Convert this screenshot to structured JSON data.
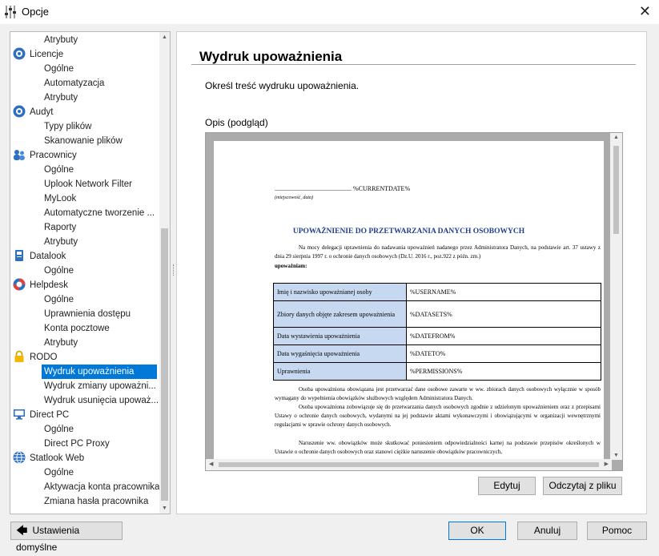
{
  "window": {
    "title": "Opcje"
  },
  "tree": {
    "items": [
      {
        "label": "Atrybuty",
        "level": 2,
        "icon": ""
      },
      {
        "label": "Licencje",
        "level": 1,
        "icon": "licence-disc-icon"
      },
      {
        "label": "Ogólne",
        "level": 2,
        "icon": ""
      },
      {
        "label": "Automatyzacja",
        "level": 2,
        "icon": ""
      },
      {
        "label": "Atrybuty",
        "level": 2,
        "icon": ""
      },
      {
        "label": "Audyt",
        "level": 1,
        "icon": "audit-disc-icon"
      },
      {
        "label": "Typy plików",
        "level": 2,
        "icon": ""
      },
      {
        "label": "Skanowanie plików",
        "level": 2,
        "icon": ""
      },
      {
        "label": "Pracownicy",
        "level": 1,
        "icon": "users-icon"
      },
      {
        "label": "Ogólne",
        "level": 2,
        "icon": ""
      },
      {
        "label": "Uplook Network Filter",
        "level": 2,
        "icon": ""
      },
      {
        "label": "MyLook",
        "level": 2,
        "icon": ""
      },
      {
        "label": "Automatyczne tworzenie ...",
        "level": 2,
        "icon": ""
      },
      {
        "label": "Raporty",
        "level": 2,
        "icon": ""
      },
      {
        "label": "Atrybuty",
        "level": 2,
        "icon": ""
      },
      {
        "label": "Datalook",
        "level": 1,
        "icon": "datalook-icon"
      },
      {
        "label": "Ogólne",
        "level": 2,
        "icon": ""
      },
      {
        "label": "Helpdesk",
        "level": 1,
        "icon": "helpdesk-icon"
      },
      {
        "label": "Ogólne",
        "level": 2,
        "icon": ""
      },
      {
        "label": "Uprawnienia dostępu",
        "level": 2,
        "icon": ""
      },
      {
        "label": "Konta pocztowe",
        "level": 2,
        "icon": ""
      },
      {
        "label": "Atrybuty",
        "level": 2,
        "icon": ""
      },
      {
        "label": "RODO",
        "level": 1,
        "icon": "lock-icon"
      },
      {
        "label": "Wydruk upoważnienia",
        "level": 2,
        "icon": "",
        "selected": true
      },
      {
        "label": "Wydruk zmiany upoważni...",
        "level": 2,
        "icon": ""
      },
      {
        "label": "Wydruk usunięcia upoważ...",
        "level": 2,
        "icon": ""
      },
      {
        "label": "Direct PC",
        "level": 1,
        "icon": "direct-pc-icon"
      },
      {
        "label": "Ogólne",
        "level": 2,
        "icon": ""
      },
      {
        "label": "Direct PC Proxy",
        "level": 2,
        "icon": ""
      },
      {
        "label": "Statlook Web",
        "level": 1,
        "icon": "statlook-web-icon"
      },
      {
        "label": "Ogólne",
        "level": 2,
        "icon": ""
      },
      {
        "label": "Aktywacja konta pracownika",
        "level": 2,
        "icon": ""
      },
      {
        "label": "Zmiana hasła pracownika",
        "level": 2,
        "icon": ""
      }
    ]
  },
  "main": {
    "title": "Wydruk upoważnienia",
    "description": "Określ treść wydruku upoważnienia.",
    "preview_label": "Opis (podgląd)",
    "edit_button": "Edytuj",
    "load_button": "Odczytaj z pliku"
  },
  "document": {
    "date_line": "................................................ %CURRENTDATE%",
    "place_line": "(miejscowość, data)",
    "heading": "UPOWAŻNIENIE DO PRZETWARZANIA DANYCH OSOBOWYCH",
    "intro": "Na mocy delegacji uprawnienia do nadawania upoważnień nadanego przez Administratora Danych, na podstawie art. 37 ustawy z dnia 29 sierpnia 1997 r. o ochronie danych osobowych (Dz.U. 2016 r., poz.922 z późn. zm.)",
    "authorize": "upoważniam:",
    "rows": [
      {
        "key": "Imię i nazwisko upoważnianej osoby",
        "value": "%USERNAME%"
      },
      {
        "key": "Zbiory danych objęte zakresem upoważnienia",
        "value": "%DATASETS%"
      },
      {
        "key": "Data wystawienia upoważnienia",
        "value": "%DATEFROM%"
      },
      {
        "key": "Data wygaśnięcia upoważnienia",
        "value": "%DATETO%"
      },
      {
        "key": "Uprawnienia",
        "value": "%PERMISSIONS%"
      }
    ],
    "para1": "Osoba upoważniona obowiązana jest przetwarzać dane osobowe zawarte w ww. zbiorach danych osobowych wyłącznie w sposób wymagany do wypełnienia obowiązków służbowych względem Administratora Danych.",
    "para2": "Osoba upoważniona zobowiązuje się do przetwarzania danych osobowych zgodnie z udzielonym upoważnieniem oraz z przepisami Ustawy o ochronie danych osobowych, wydanymi na jej podstawie aktami wykonawczymi i obowiązującymi w organizacji wewnętrznymi regulacjami w sprawie ochrony danych osobowych.",
    "para3": "Naruszenie ww. obowiązków może skutkować poniesieniem odpowiedzialności karnej na podstawie przepisów określonych w Ustawie o ochronie danych osobowych oraz stanowi ciężkie naruszenie obowiązków pracowniczych,"
  },
  "footer": {
    "defaults_button": "Ustawienia domyślne",
    "ok_button": "OK",
    "cancel_button": "Anuluj",
    "help_button": "Pomoc"
  }
}
